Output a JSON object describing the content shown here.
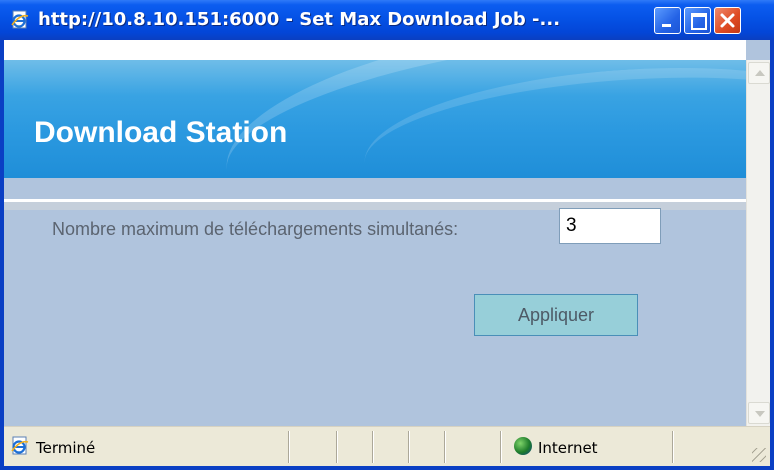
{
  "window": {
    "title": "http://10.8.10.151:6000 - Set Max Download Job -..."
  },
  "banner": {
    "title": "Download Station"
  },
  "form": {
    "label": "Nombre maximum de téléchargements simultanés:",
    "value": "3",
    "apply_label": "Appliquer"
  },
  "statusbar": {
    "status_text": "Terminé",
    "zone_text": "Internet"
  },
  "colors": {
    "titlebar": "#0552e6",
    "banner": "#2b99e0",
    "content_bg": "#b0c4dd",
    "button_bg": "#97cfd9",
    "close_button": "#de4a22"
  },
  "icons": {
    "title": "ie-page-icon",
    "status": "ie-page-icon",
    "zone": "globe-icon"
  }
}
